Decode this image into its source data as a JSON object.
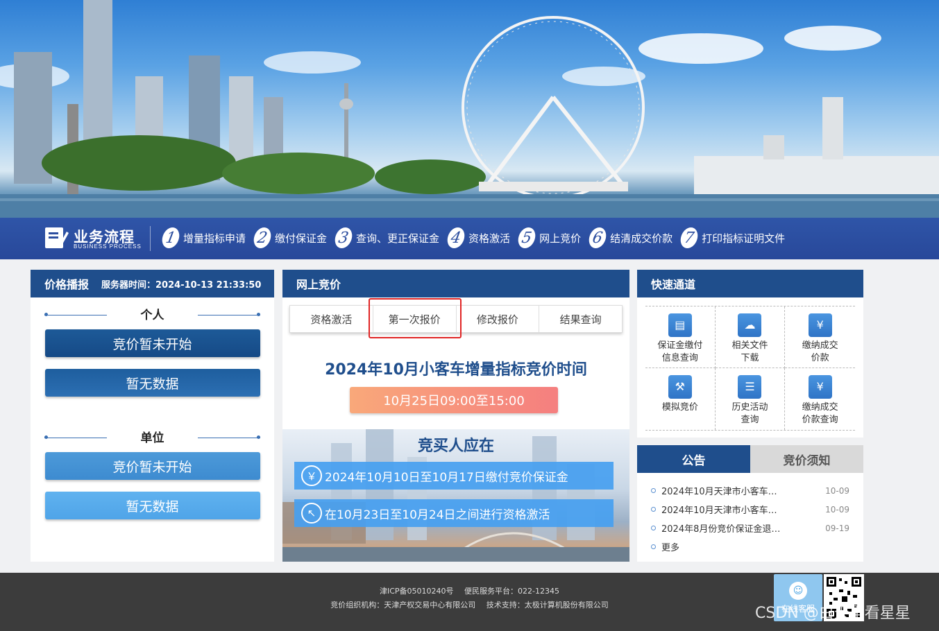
{
  "process": {
    "title": "业务流程",
    "subtitle": "BUSINESS PROCESS",
    "steps": [
      {
        "num": "1",
        "label": "增量指标申请"
      },
      {
        "num": "2",
        "label": "缴付保证金"
      },
      {
        "num": "3",
        "label": "查询、更正保证金"
      },
      {
        "num": "4",
        "label": "资格激活"
      },
      {
        "num": "5",
        "label": "网上竞价"
      },
      {
        "num": "6",
        "label": "结清成交价款"
      },
      {
        "num": "7",
        "label": "打印指标证明文件"
      }
    ]
  },
  "left": {
    "title": "价格播报",
    "server_time": "服务器时间：2024-10-13 21:33:50",
    "personal": {
      "heading": "个人",
      "status": "竞价暂未开始",
      "data": "暂无数据"
    },
    "unit": {
      "heading": "单位",
      "status": "竞价暂未开始",
      "data": "暂无数据"
    }
  },
  "mid": {
    "title": "网上竞价",
    "tabs": [
      "资格激活",
      "第一次报价",
      "修改报价",
      "结果查询"
    ],
    "headline": "2024年10月小客车增量指标竞价时间",
    "time_range": "10月25日09:00至15:00",
    "sub": "竞买人应在",
    "info": [
      {
        "icon": "￥",
        "text": "2024年10月10日至10月17日缴付竞价保证金"
      },
      {
        "icon": "↖",
        "text": "在10月23日至10月24日之间进行资格激活"
      }
    ]
  },
  "quick": {
    "title": "快速通道",
    "items": [
      {
        "line1": "保证金缴付",
        "line2": "信息查询",
        "icon": "card-icon"
      },
      {
        "line1": "相关文件",
        "line2": "下载",
        "icon": "cloud-download-icon"
      },
      {
        "line1": "缴纳成交",
        "line2": "价款",
        "icon": "money-bag-icon"
      },
      {
        "line1": "模拟竞价",
        "line2": "",
        "icon": "gavel-icon"
      },
      {
        "line1": "历史活动",
        "line2": "查询",
        "icon": "calendar-icon"
      },
      {
        "line1": "缴纳成交",
        "line2": "价款查询",
        "icon": "money-search-icon"
      }
    ]
  },
  "notice": {
    "tabs": [
      "公告",
      "竞价须知"
    ],
    "items": [
      {
        "text": "2024年10月天津市小客车…",
        "date": "10-09"
      },
      {
        "text": "2024年10月天津市小客车…",
        "date": "10-09"
      },
      {
        "text": "2024年8月份竞价保证金退…",
        "date": "09-19"
      },
      {
        "text": "更多",
        "date": ""
      }
    ]
  },
  "footer": {
    "icp": "津ICP备05010240号",
    "hotline": "便民服务平台：022-12345",
    "org": "竞价组织机构：天津产权交易中心有限公司",
    "tech": "技术支持：太极计算机股份有限公司",
    "kefu": "在线客服"
  },
  "watermark": "CSDN @白天里看星星"
}
